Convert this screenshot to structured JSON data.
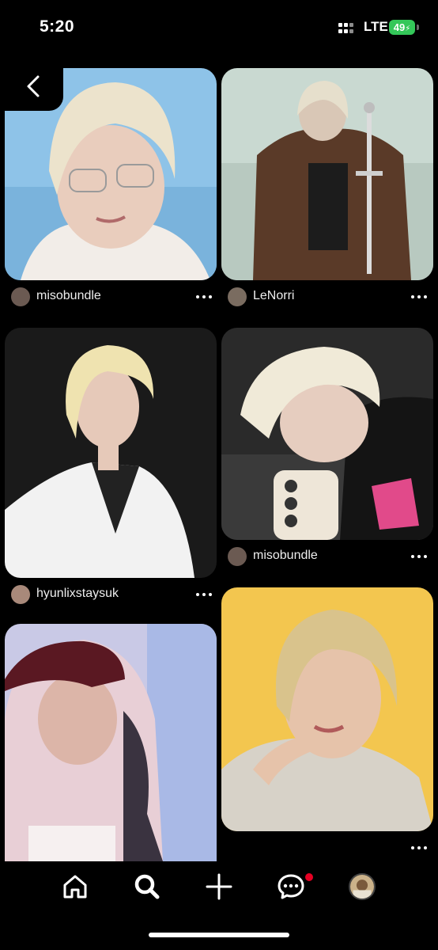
{
  "status_bar": {
    "time": "5:20",
    "network": "LTE",
    "battery": "49"
  },
  "pins": [
    {
      "id": "pin-1",
      "user": "misobundle",
      "bg": "#8ec3e8"
    },
    {
      "id": "pin-2",
      "user": "LeNorri",
      "bg": "#c9d9d1"
    },
    {
      "id": "pin-3",
      "user": "hyunlixstaysuk",
      "bg": "#1a1a1a"
    },
    {
      "id": "pin-4",
      "user": "misobundle",
      "bg": "#2a2a2a"
    },
    {
      "id": "pin-5",
      "bg": "#c9c9e6"
    },
    {
      "id": "pin-6",
      "bg": "#f3c64f"
    }
  ],
  "nav": {
    "items": [
      {
        "name": "home-icon"
      },
      {
        "name": "search-icon"
      },
      {
        "name": "create-icon"
      },
      {
        "name": "messages-icon"
      },
      {
        "name": "profile-avatar"
      }
    ],
    "notification_color": "#e60023"
  },
  "colors": {
    "background": "#000000",
    "battery": "#34c759"
  }
}
